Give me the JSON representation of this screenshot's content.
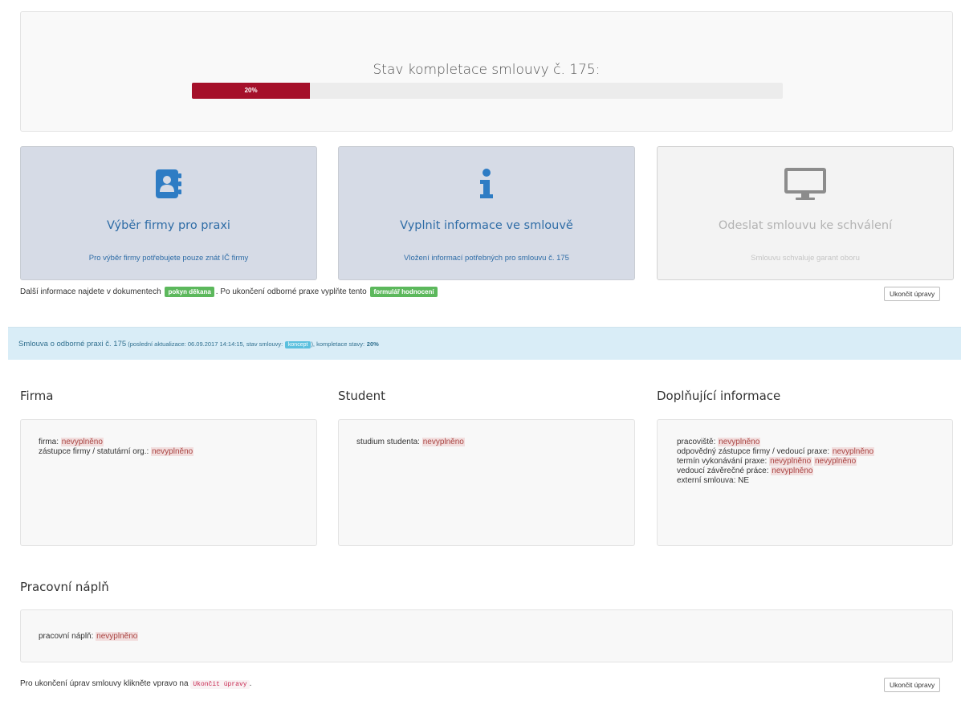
{
  "progress": {
    "title": "Stav kompletace smlouvy č. 175:",
    "percent_label": "20%",
    "percent": 20,
    "bar_color": "#a5102a"
  },
  "cards": [
    {
      "title": "Výběr firmy pro praxi",
      "subtitle": "Pro výběr firmy potřebujete pouze znát IČ firmy",
      "icon": "address-book-icon",
      "state": "active"
    },
    {
      "title": "Vyplnit informace ve smlouvě",
      "subtitle": "Vložení informací potřebných pro smlouvu č. 175",
      "icon": "info-icon",
      "state": "active"
    },
    {
      "title": "Odeslat smlouvu ke schválení",
      "subtitle": "Smlouvu schvaluje garant oboru",
      "icon": "monitor-icon",
      "state": "disabled"
    }
  ],
  "info_line": {
    "text1": "Další informace najdete v dokumentech",
    "link1": "pokyn děkana",
    "text2": ". Po ukončení odborné praxe vyplňte tento",
    "link2": "formulář hodnocení"
  },
  "finish_button": "Ukončit úpravy",
  "status_bar": {
    "text1": "Smlouva o odborné praxi č. 175",
    "meta1": " (poslední aktualizace: 06.09.2017 14:14:15, stav smlouvy:",
    "badge": "koncept",
    "meta2": "), kompletace stavy:",
    "percent": "20%"
  },
  "sections": {
    "firma": {
      "heading": "Firma",
      "rows": [
        {
          "label": "firma:",
          "value": "nevyplněno"
        },
        {
          "label": "zástupce firmy / statutární org.:",
          "value": "nevyplněno"
        }
      ]
    },
    "student": {
      "heading": "Student",
      "rows": [
        {
          "label": "studium studenta:",
          "value": "nevyplněno"
        }
      ]
    },
    "doplnujici": {
      "heading": "Doplňující informace",
      "rows": [
        {
          "label": "pracoviště:",
          "value": "nevyplněno"
        },
        {
          "label": "odpovědný zástupce firmy / vedoucí praxe:",
          "value": "nevyplněno"
        },
        {
          "label": "termín vykonávání praxe:",
          "value": "nevyplněno",
          "value2": "nevyplněno"
        },
        {
          "label": "vedoucí závěrečné práce:",
          "value": "nevyplněno"
        },
        {
          "label": "externí smlouva:",
          "plain": "NE"
        }
      ]
    },
    "napln": {
      "heading": "Pracovní náplň",
      "rows": [
        {
          "label": "pracovní náplň:",
          "value": "nevyplněno"
        }
      ]
    }
  },
  "bottom": {
    "text": "Pro ukončení úprav smlouvy klikněte vpravo na",
    "code": "Ukončit úpravy",
    "tail": "."
  }
}
